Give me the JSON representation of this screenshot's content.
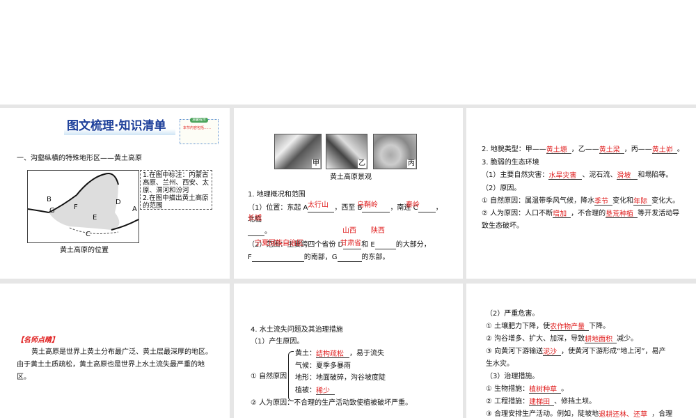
{
  "s1": {
    "title": "图文梳理·知识清单",
    "note_tag": "温馨提示",
    "note_text": "本节内容包括……",
    "heading": "一、沟壑纵横的特殊地形区——黄土高原",
    "map_labels": [
      "A",
      "B",
      "C",
      "D",
      "E",
      "F",
      "G"
    ],
    "task": [
      "1.在图中标注：内蒙古",
      "高原、兰州、西安、太",
      "原、渭河和汾河",
      "2.在图中描出黄土高原",
      "的范围"
    ],
    "caption": "黄土高原的位置"
  },
  "s2": {
    "photo_labels": [
      "甲",
      "乙",
      "丙"
    ],
    "caption": "黄土高原景观",
    "h1": "1. 地理概况和范围",
    "l1a": "（1）位置：东起 A",
    "l1b": "，西至 B",
    "l1c": "，南连 C",
    "l1d": "，",
    "l2": "北临",
    "l3": "。",
    "l4a": "（2）范围：主要跨四个省份 D",
    "l4b": "和 E",
    "l4c": "的大部分，",
    "l5a": "F",
    "l5b": "的南部，G",
    "l5c": "的东部。",
    "ans": [
      "太行山",
      "乌鞘岭",
      "秦岭",
      "长城",
      "山西",
      "陕西",
      "宁夏回族自治区",
      "甘肃省"
    ]
  },
  "s3": {
    "l1a": "2. 地貌类型：甲——",
    "l1b": "，乙——",
    "l1c": "，丙——",
    "l1d": "。",
    "a1": "黄土塬",
    "a2": "黄土梁",
    "a3": "黄土峁",
    "l2": "3. 脆弱的生态环境",
    "l3a": "（1）主要自然灾害：",
    "a4": "水旱灾害",
    "l3b": "、泥石流、",
    "a5": "滑坡",
    "l3c": "和塌陷等。",
    "l4": "（2）原因。",
    "l5a": "① 自然原因：属温带季风气候，降水",
    "a6": "季节",
    "l5b": "变化和",
    "a7": "年际",
    "l5c": "变化大。",
    "l6a": "② 人为原因：人口不断",
    "a8": "增加",
    "l6b": "，不合理的",
    "a9": "垦荒种植",
    "l6c": "等开发活动导",
    "l7": "致生态破坏。"
  },
  "s4": {
    "tag": "【名师点睛】",
    "p1": "黄土高原是世界上黄土分布最广泛、黄土层最深厚的地区。",
    "p2": "由于黄土土质疏松，黄土高原也是世界上水土流失最严重的地",
    "p3": "区。"
  },
  "s5": {
    "h": "4. 水土流失问题及其治理措施",
    "l1": "（1）产生原因。",
    "nat": "① 自然原因",
    "b1": "黄土：",
    "a1": "结构疏松",
    "b1b": "，易于流失",
    "b2": "气候：夏季多暴雨",
    "b3": "地形：地面破碎，沟谷坡度陡",
    "b4": "植被：",
    "a2": "稀少",
    "l2": "② 人为原因：不合理的生产活动致使植被破坏严重。"
  },
  "s6": {
    "l1": "（2）严重危害。",
    "l2a": "① 土壤肥力下降，使",
    "a1": "农作物产量",
    "l2b": "下降。",
    "l3a": "② 沟谷增多、扩大、加深，导致",
    "a2": "耕地面积",
    "l3b": "减少。",
    "l4a": "③ 向黄河下游输送",
    "a3": "泥沙",
    "l4b": "，使黄河下游形成“地上河”，易产",
    "l5": "生水灾。",
    "l6": "（3）治理措施。",
    "l7a": "① 生物措施：",
    "a4": "植树种草",
    "l7b": "。",
    "l8a": "② 工程措施：",
    "a5": "建梯田",
    "l8b": "、修挡土坝。",
    "l9a": "③ 合理安排生产活动。例如，陡坡地",
    "a6": "退耕还林、还草",
    "l9b": "，合理"
  }
}
